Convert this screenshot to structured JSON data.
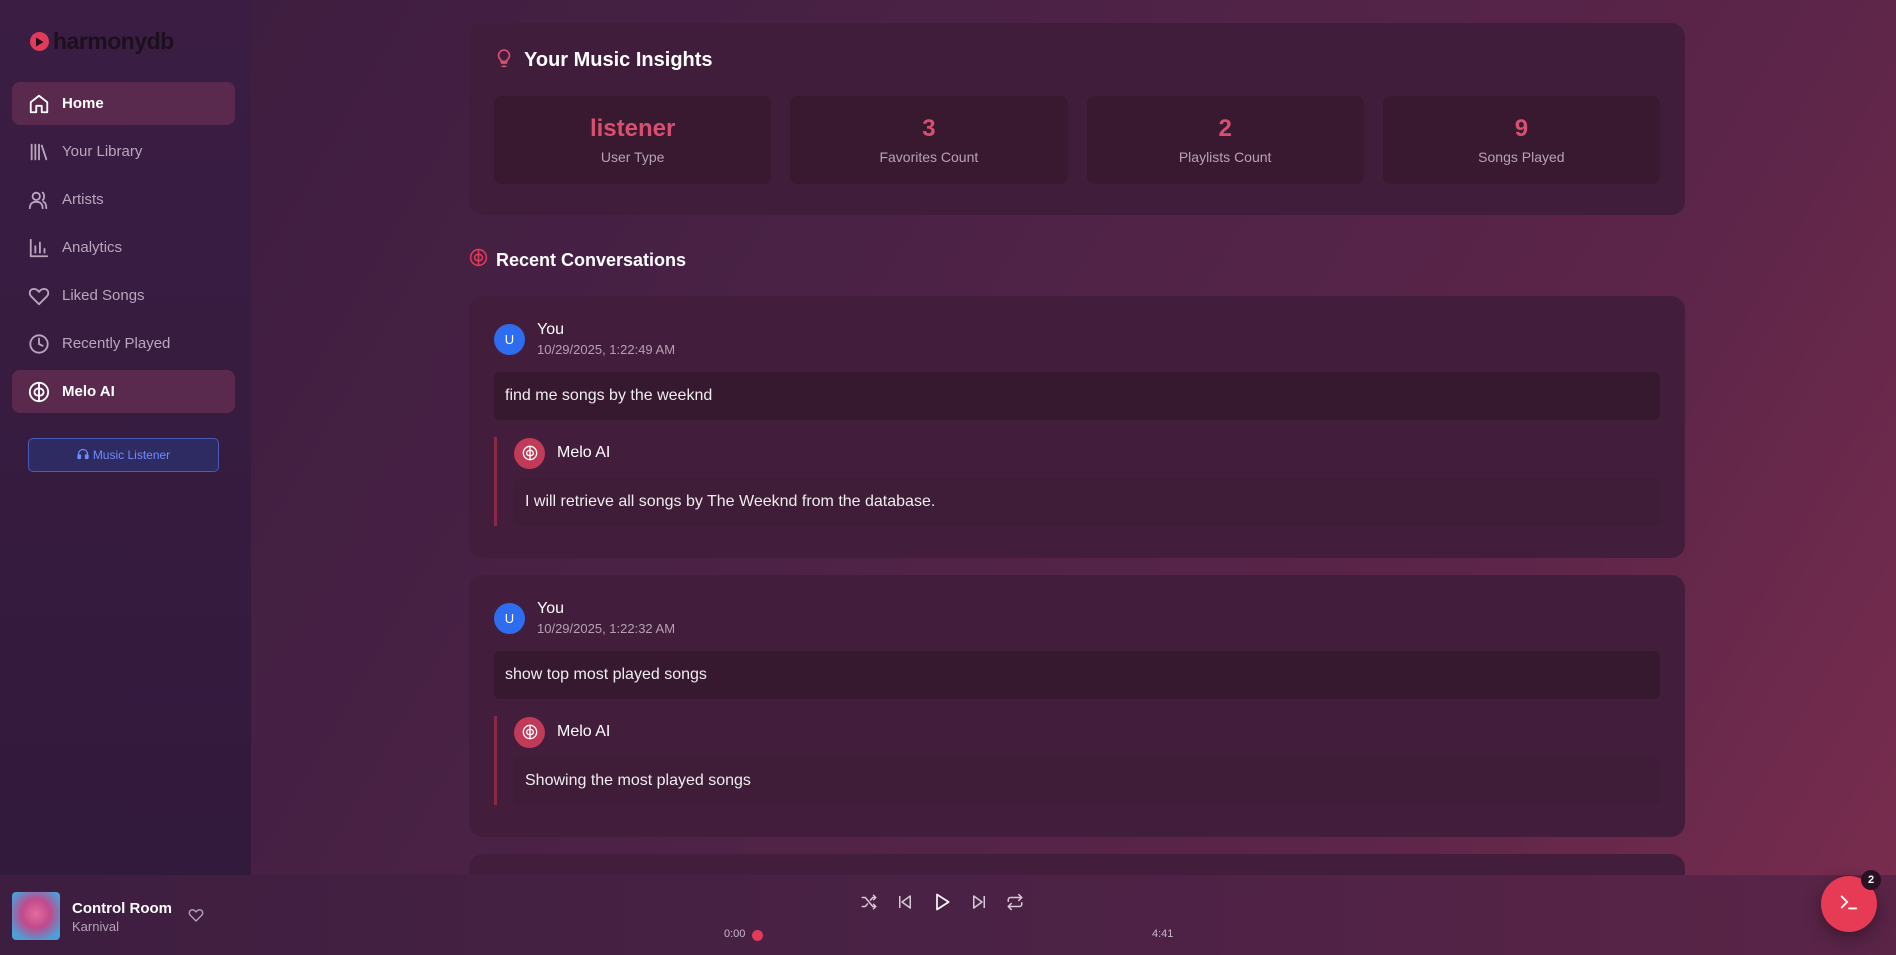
{
  "app": {
    "logo_text": "harmonydb"
  },
  "sidebar": {
    "items": [
      {
        "label": "Home",
        "icon": "home-icon"
      },
      {
        "label": "Your Library",
        "icon": "library-icon"
      },
      {
        "label": "Artists",
        "icon": "users-icon"
      },
      {
        "label": "Analytics",
        "icon": "bar-chart-icon"
      },
      {
        "label": "Liked Songs",
        "icon": "heart-icon"
      },
      {
        "label": "Recently Played",
        "icon": "clock-icon"
      },
      {
        "label": "Melo AI",
        "icon": "brain-icon"
      }
    ],
    "role_badge": "Music Listener"
  },
  "insights": {
    "title": "Your Music Insights",
    "stats": [
      {
        "value": "listener",
        "label": "User Type"
      },
      {
        "value": "3",
        "label": "Favorites Count"
      },
      {
        "value": "2",
        "label": "Playlists Count"
      },
      {
        "value": "9",
        "label": "Songs Played"
      }
    ]
  },
  "recent": {
    "title": "Recent Conversations",
    "conversations": [
      {
        "user": "You",
        "avatar": "U",
        "time": "10/29/2025, 1:22:49 AM",
        "query": "find me songs by the weeknd",
        "ai_name": "Melo AI",
        "reply": "I will retrieve all songs by The Weeknd from the database."
      },
      {
        "user": "You",
        "avatar": "U",
        "time": "10/29/2025, 1:22:32 AM",
        "query": "show top most played songs",
        "ai_name": "Melo AI",
        "reply": "Showing the most played songs"
      }
    ]
  },
  "player": {
    "title": "Control Room",
    "artist": "Karnival",
    "current_time": "0:00",
    "total_time": "4:41",
    "progress": 0
  },
  "terminal": {
    "badge": "2"
  },
  "colors": {
    "accent": "#e23a5a",
    "stat_value": "#d8506f",
    "user_avatar": "#2f6df0"
  }
}
